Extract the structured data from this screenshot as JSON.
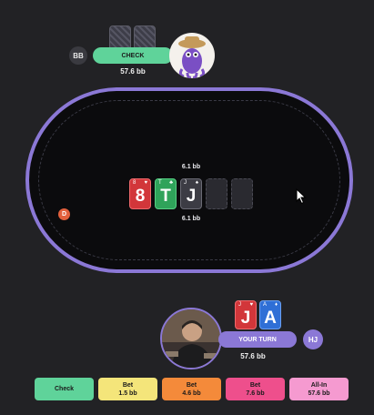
{
  "opponent": {
    "position": "BB",
    "action": "CHECK",
    "stack": "57.6 bb"
  },
  "board": {
    "pot_top": "6.1 bb",
    "pot_bottom": "6.1 bb",
    "cards": [
      {
        "rank": "8",
        "suit": "♥",
        "color": "#d2363a"
      },
      {
        "rank": "T",
        "suit": "♣",
        "color": "#2fa35a"
      },
      {
        "rank": "J",
        "suit": "♠",
        "color": "#3c3c44"
      }
    ]
  },
  "dealer_button": "D",
  "hero": {
    "position": "HJ",
    "status": "YOUR TURN",
    "stack": "57.6 bb",
    "cards": [
      {
        "rank": "J",
        "suit": "♥",
        "color": "#d2363a"
      },
      {
        "rank": "A",
        "suit": "♦",
        "color": "#2f6fd6"
      }
    ]
  },
  "actions": [
    {
      "label": "Check",
      "amount": "",
      "color": "#5fd39a"
    },
    {
      "label": "Bet",
      "amount": "1.5 bb",
      "color": "#f4e57a"
    },
    {
      "label": "Bet",
      "amount": "4.6 bb",
      "color": "#f48a3a"
    },
    {
      "label": "Bet",
      "amount": "7.6 bb",
      "color": "#ee4f8c"
    },
    {
      "label": "All-In",
      "amount": "57.6 bb",
      "color": "#f59ad0"
    }
  ]
}
